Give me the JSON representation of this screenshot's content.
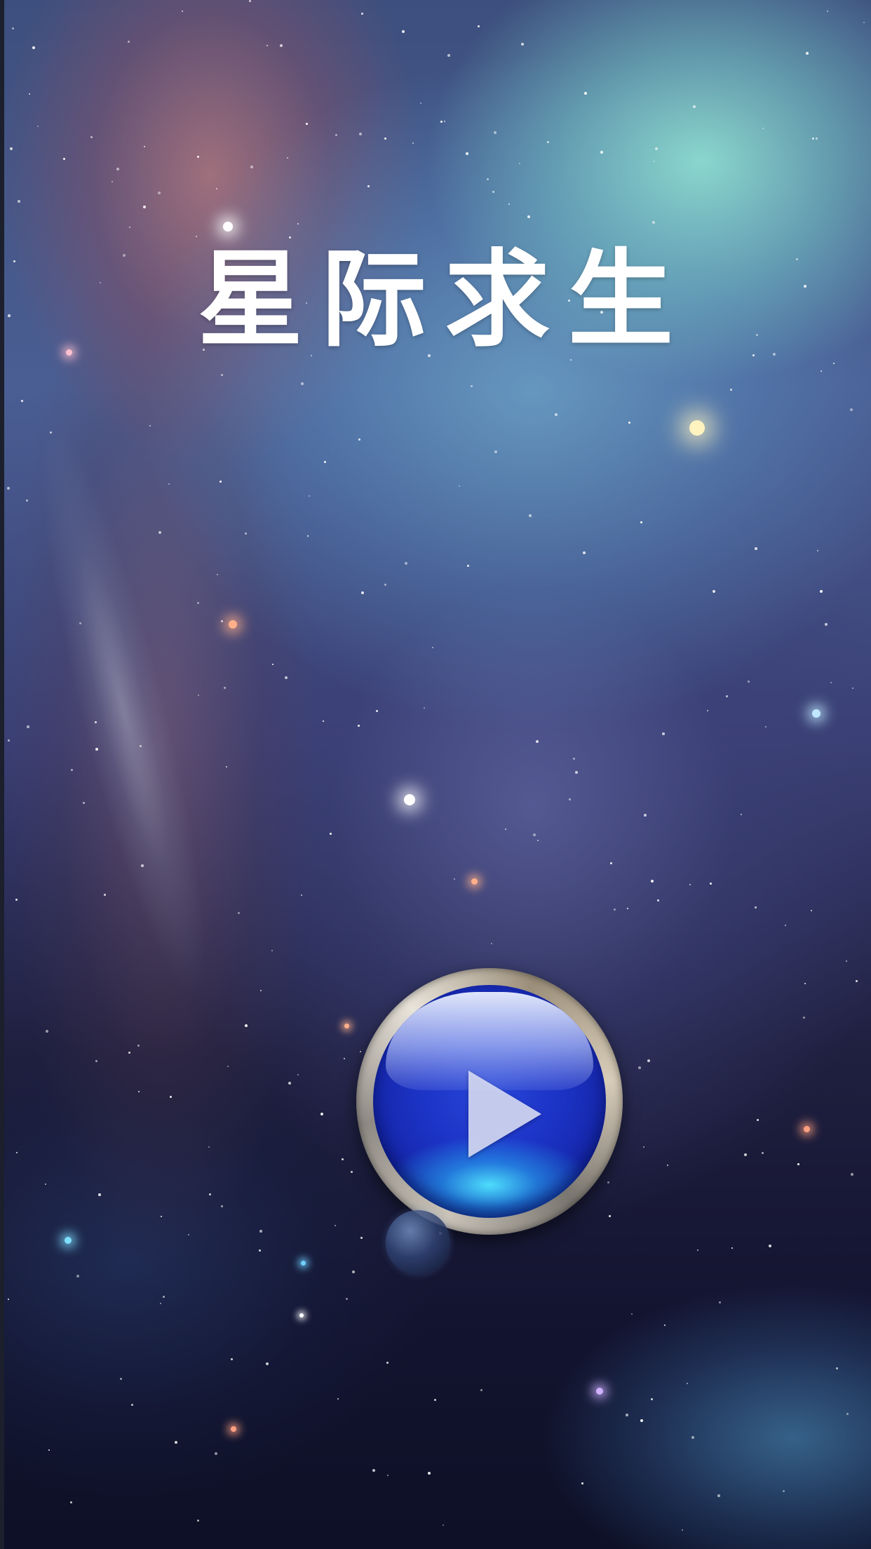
{
  "game": {
    "title": "星际求生"
  },
  "controls": {
    "play_button_icon": "play-icon"
  },
  "colors": {
    "title_text": "#ffffff",
    "play_orb": "#1c33c6",
    "play_orb_glow": "#50e6ff",
    "play_bezel": "#c9c3b8"
  }
}
